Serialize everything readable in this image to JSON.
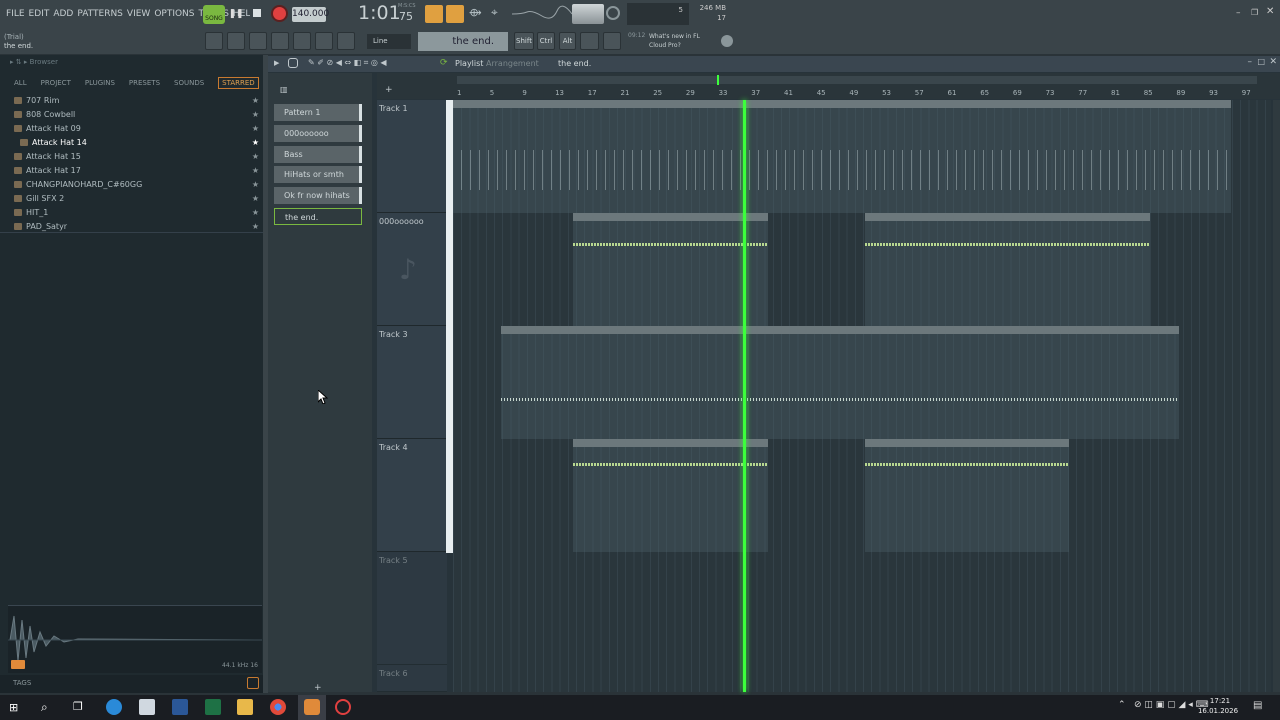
{
  "menu": [
    "FILE",
    "EDIT",
    "ADD",
    "PATTERNS",
    "VIEW",
    "OPTIONS",
    "TOOLS",
    "HELP"
  ],
  "transport": {
    "song_label": "SONG",
    "tempo": "140.000",
    "time": "1:01",
    "time_small": "75",
    "mscs": "M:S:CS",
    "cpu": "5",
    "mem": "246 MB",
    "voices": "17"
  },
  "hint": {
    "trial": "(Trial)",
    "file": "the end."
  },
  "toolbar2": {
    "snap": "Line",
    "pattern": "the end.",
    "shift": "Shift",
    "ctrl": "Ctrl",
    "alt": "Alt",
    "news_time": "09:12",
    "news": "What's new in FL Cloud Pro?"
  },
  "browser": {
    "title": "Browser",
    "tabs": [
      "ALL",
      "PROJECT",
      "PLUGINS",
      "PRESETS",
      "SOUNDS",
      "STARRED"
    ],
    "items": [
      "707 Rim",
      "808 Cowbell",
      "Attack Hat 09",
      "Attack Hat 14",
      "Attack Hat 15",
      "Attack Hat 17",
      "CHANGPIANOHARD_C#60GG",
      "Gill SFX 2",
      "HIT_1",
      "PAD_Satyr"
    ],
    "sample_info": "44.1 kHz 16",
    "tags": "TAGS"
  },
  "playlist": {
    "title": "Playlist",
    "sub": "Arrangement",
    "pattern": "the end.",
    "patterns": [
      "Pattern 1",
      "000oooooo",
      "Bass",
      "HiHats or smth",
      "Ok fr now hihats",
      "the end."
    ],
    "tracks": [
      "Track 1",
      "000oooooo",
      "Track 3",
      "Track 4",
      "Track 5",
      "Track 6"
    ],
    "bars": [
      "1",
      "5",
      "9",
      "13",
      "17",
      "21",
      "25",
      "29",
      "33",
      "37",
      "41",
      "45",
      "49",
      "53",
      "57",
      "61",
      "65",
      "69",
      "73",
      "77",
      "81",
      "85",
      "89",
      "93",
      "97"
    ]
  },
  "clock": {
    "time": "17:21",
    "date": "16.01.2026"
  },
  "colors": {
    "accent_green": "#7ab840",
    "record": "#e04040",
    "playhead": "#3cff3c"
  }
}
